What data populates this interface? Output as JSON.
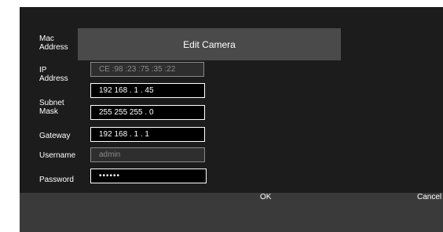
{
  "dialog": {
    "title": "Edit Camera"
  },
  "labels": {
    "mac": "Mac\nAddress",
    "ip": "IP\nAddress",
    "subnet": "Subnet\nMask",
    "gateway": "Gateway",
    "username": "Username",
    "password": "Password"
  },
  "fields": {
    "mac": "CE :98 :23 :75 :35 :22",
    "ip": "192 168 . 1 . 45",
    "subnet": "255 255 255 . 0",
    "gateway": "192 168 . 1 . 1",
    "username": "admin",
    "password": "••••••"
  },
  "buttons": {
    "ok": "OK",
    "cancel": "Cancel"
  }
}
